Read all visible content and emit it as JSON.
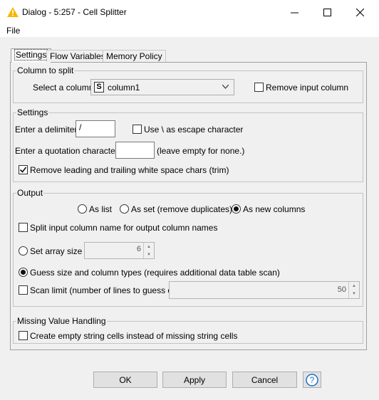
{
  "window": {
    "title": "Dialog - 5:257 - Cell Splitter",
    "warning_icon_color": "#f5b800"
  },
  "menu": {
    "file": "File"
  },
  "tabs": [
    {
      "label": "Settings",
      "active": true
    },
    {
      "label": "Flow Variables",
      "active": false
    },
    {
      "label": "Memory Policy",
      "active": false
    }
  ],
  "column_group": {
    "legend": "Column to split",
    "select_label": "Select a column:",
    "type_badge": "S",
    "selected_column": "column1",
    "remove_input_label": "Remove input column",
    "remove_input_checked": false
  },
  "settings_group": {
    "legend": "Settings",
    "delimiter_label": "Enter a delimiter:",
    "delimiter_value": "/",
    "escape_label": "Use \\ as escape character",
    "escape_checked": false,
    "quotation_label": "Enter a quotation character:",
    "quotation_value": "",
    "quotation_hint": "(leave empty for none.)",
    "trim_label": "Remove leading and trailing white space chars (trim)",
    "trim_checked": true
  },
  "output_group": {
    "legend": "Output",
    "as_list_label": "As list",
    "as_set_label": "As set (remove duplicates)",
    "as_new_columns_label": "As new columns",
    "selected_mode": "As new columns",
    "split_name_label": "Split input column name for output column names",
    "split_name_checked": false,
    "set_array_size_label": "Set array size",
    "array_size_value": "6",
    "guess_label": "Guess size and column types (requires additional data table scan)",
    "size_mode_selected": "guess",
    "scan_limit_label": "Scan limit (number of lines to guess on)",
    "scan_limit_checked": false,
    "scan_limit_value": "50"
  },
  "missing_group": {
    "legend": "Missing Value Handling",
    "empty_cells_label": "Create empty string cells instead of missing string cells",
    "empty_cells_checked": false
  },
  "buttons": {
    "ok": "OK",
    "apply": "Apply",
    "cancel": "Cancel",
    "help_icon_color": "#1a73c8"
  }
}
